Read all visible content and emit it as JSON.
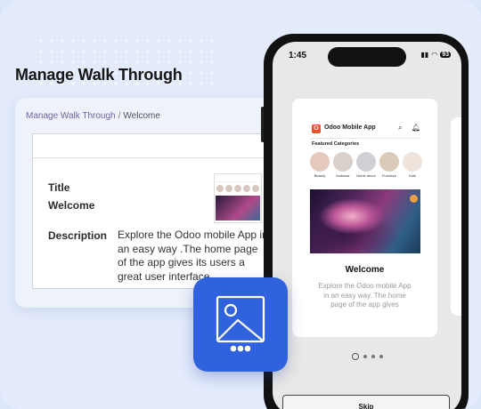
{
  "page": {
    "heading": "Manage Walk Through"
  },
  "form": {
    "breadcrumb_parent": "Manage Walk Through",
    "breadcrumb_separator": "/",
    "breadcrumb_current": "Welcome",
    "title_label": "Title",
    "title_value": "Welcome",
    "description_label": "Description",
    "description_value": "Explore the Odoo mobile App in an easy way .The home page of the app gives its users a great user interface."
  },
  "phone": {
    "time": "1:45",
    "battery": "93",
    "app": {
      "logo_letter": "O",
      "title": "Odoo Mobile App",
      "featured_title": "Featured Categories",
      "categories": [
        {
          "label": "Beauty",
          "color": "#e6c9bd"
        },
        {
          "label": "footwear",
          "color": "#d7d0cb"
        },
        {
          "label": "Home decor",
          "color": "#cfd0d4"
        },
        {
          "label": "Furniture",
          "color": "#d9cbb8"
        },
        {
          "label": "Kids",
          "color": "#efe4dc"
        }
      ]
    },
    "walkthrough": {
      "title": "Welcome",
      "description": "Explore the Odoo mobile App in an easy way. The home page of the app gives"
    },
    "page_count": 4,
    "active_page": 1,
    "skip_label": "Skip"
  },
  "colors": {
    "accent_blue": "#2f62dc",
    "odoo_purple": "#71639e",
    "background": "#e3ebfc"
  }
}
